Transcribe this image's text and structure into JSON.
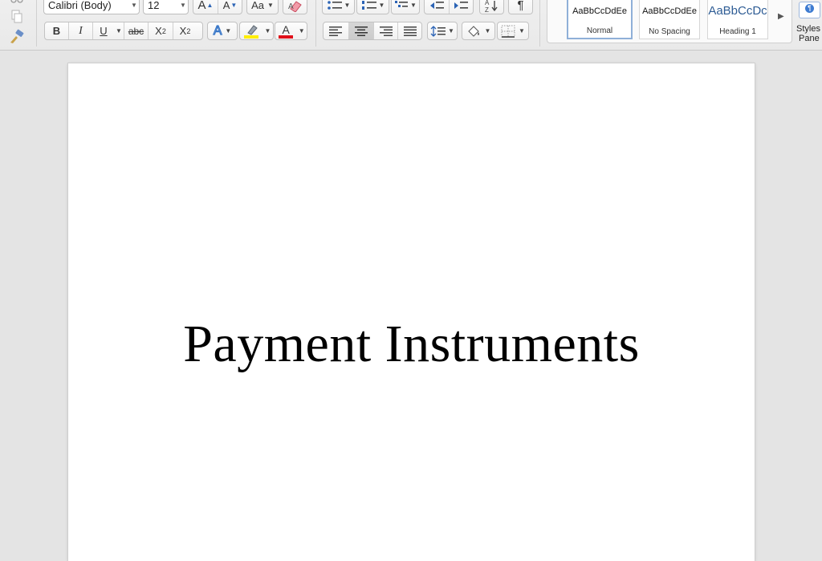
{
  "font": {
    "name": "Calibri (Body)",
    "size": "12"
  },
  "format": {
    "bold": "B",
    "italic": "I",
    "underline": "U",
    "strikethrough": "abc",
    "subscript": "X",
    "subscript_sub": "2",
    "superscript": "X",
    "superscript_sup": "2",
    "grow_font": "A",
    "shrink_font": "A",
    "change_case": "Aa",
    "font_color": "A",
    "text_effects": "A"
  },
  "colors": {
    "highlight": "#ffee00",
    "font_color": "#e0101a",
    "text_effects": "#3a78c8"
  },
  "paragraph": {
    "show_marks": "¶",
    "alignment_selected": "center"
  },
  "styles": {
    "items": [
      {
        "sample": "AaBbCcDdEe",
        "name": "Normal"
      },
      {
        "sample": "AaBbCcDdEe",
        "name": "No Spacing"
      },
      {
        "sample": "AaBbCcDc",
        "name": "Heading 1"
      }
    ],
    "pane_label_line1": "Styles",
    "pane_label_line2": "Pane",
    "pane_icon": "¶"
  },
  "document": {
    "title": "Payment Instruments"
  }
}
